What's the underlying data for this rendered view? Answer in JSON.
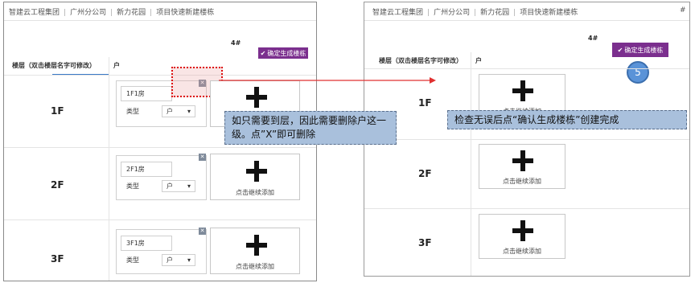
{
  "left": {
    "breadcrumb": [
      "智建云工程集团",
      "广州分公司",
      "新力花园",
      "项目快速新建楼栋"
    ],
    "building_number": "4#",
    "confirm_button": "确定生成楼栋",
    "header_floor": "楼层（双击楼层名字可修改）",
    "header_unit": "户",
    "floors": [
      {
        "label": "1F",
        "unit": "1F1房",
        "type_label": "类型",
        "type_value": "户",
        "add_text": ""
      },
      {
        "label": "2F",
        "unit": "2F1房",
        "type_label": "类型",
        "type_value": "户",
        "add_text": "点击继续添加"
      },
      {
        "label": "3F",
        "unit": "3F1房",
        "type_label": "类型",
        "type_value": "户",
        "add_text": "点击继续添加"
      }
    ],
    "callout": "如只需要到层，因此需要删除户这一级。点”X”即可删除"
  },
  "right": {
    "breadcrumb": [
      "智建云工程集团",
      "广州分公司",
      "新力花园",
      "项目快速新建楼栋"
    ],
    "building_number": "4#",
    "confirm_button": "确定生成楼栋",
    "step_number": "5",
    "header_floor": "楼层（双击楼层名字可修改）",
    "header_unit": "户",
    "floors": [
      {
        "label": "1F",
        "add_text": "点击继续添加"
      },
      {
        "label": "2F",
        "add_text": "点击继续添加"
      },
      {
        "label": "3F",
        "add_text": "点击继续添加"
      }
    ],
    "callout": "检查无误后点“确认生成楼栋”创建完成",
    "corner_mark": "#"
  },
  "colors": {
    "confirm_button": "#7b2f8e",
    "callout_bg": "#a9c0dc",
    "highlight": "#d11111",
    "arrow": "#e03030",
    "step_badge": "#5a93d8"
  },
  "icons": [
    "check-icon",
    "close-icon",
    "plus-icon",
    "chevron-down-icon"
  ]
}
